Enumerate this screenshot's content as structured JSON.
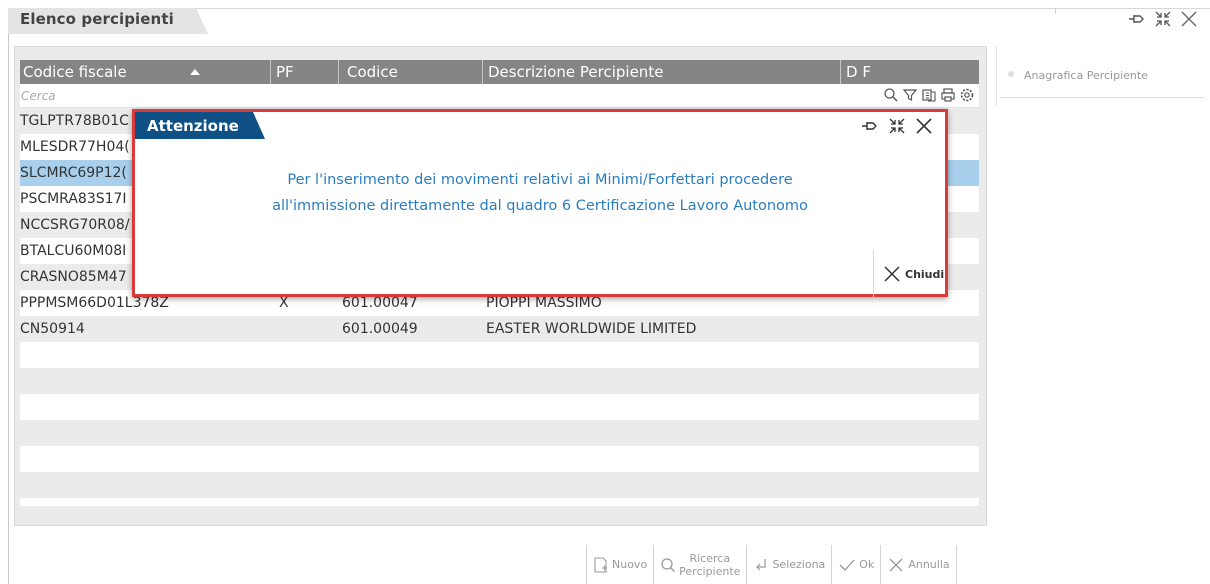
{
  "window": {
    "title": "Elenco percipienti"
  },
  "grid": {
    "columns": [
      "Codice fiscale",
      "PF",
      "Codice",
      "Descrizione Percipiente",
      "D F"
    ],
    "filter_placeholder": "Cerca",
    "rows": [
      {
        "cf": "TGLPTR78B01C",
        "pf": "",
        "codice": "",
        "descrizione": ""
      },
      {
        "cf": "MLESDR77H04(",
        "pf": "",
        "codice": "",
        "descrizione": ""
      },
      {
        "cf": "SLCMRC69P12(",
        "pf": "",
        "codice": "",
        "descrizione": ""
      },
      {
        "cf": "PSCMRA83S17I",
        "pf": "",
        "codice": "",
        "descrizione": ""
      },
      {
        "cf": "NCCSRG70R08/",
        "pf": "",
        "codice": "",
        "descrizione": ""
      },
      {
        "cf": "BTALCU60M08I",
        "pf": "",
        "codice": "",
        "descrizione": ""
      },
      {
        "cf": "CRASNO85M47",
        "pf": "",
        "codice": "",
        "descrizione": ""
      },
      {
        "cf": "PPPMSM66D01L378Z",
        "pf": "X",
        "codice": "601.00047",
        "descrizione": "PIOPPI MASSIMO"
      },
      {
        "cf": "CN50914",
        "pf": "",
        "codice": "601.00049",
        "descrizione": "EASTER WORLDWIDE LIMITED"
      }
    ],
    "selected_row_index": 2
  },
  "side_panel": {
    "items": [
      {
        "label": "Anagrafica Percipiente"
      }
    ]
  },
  "toolbar": {
    "nuovo": "Nuovo",
    "ricerca_line1": "Ricerca",
    "ricerca_line2": "Percipiente",
    "seleziona": "Seleziona",
    "ok": "Ok",
    "annulla": "Annulla"
  },
  "dialog": {
    "title": "Attenzione",
    "message_line1": "Per l'inserimento dei movimenti relativi ai Minimi/Forfettari procedere",
    "message_line2": "all'immissione direttamente dal quadro 6 Certificazione Lavoro Autonomo",
    "close_label": "Chiudi"
  },
  "colors": {
    "dialog_header": "#0e4f86",
    "dialog_border": "#d93a3a",
    "message_text": "#2a7dbf",
    "grid_header": "#858585",
    "selected_row": "#a8d0ec"
  }
}
